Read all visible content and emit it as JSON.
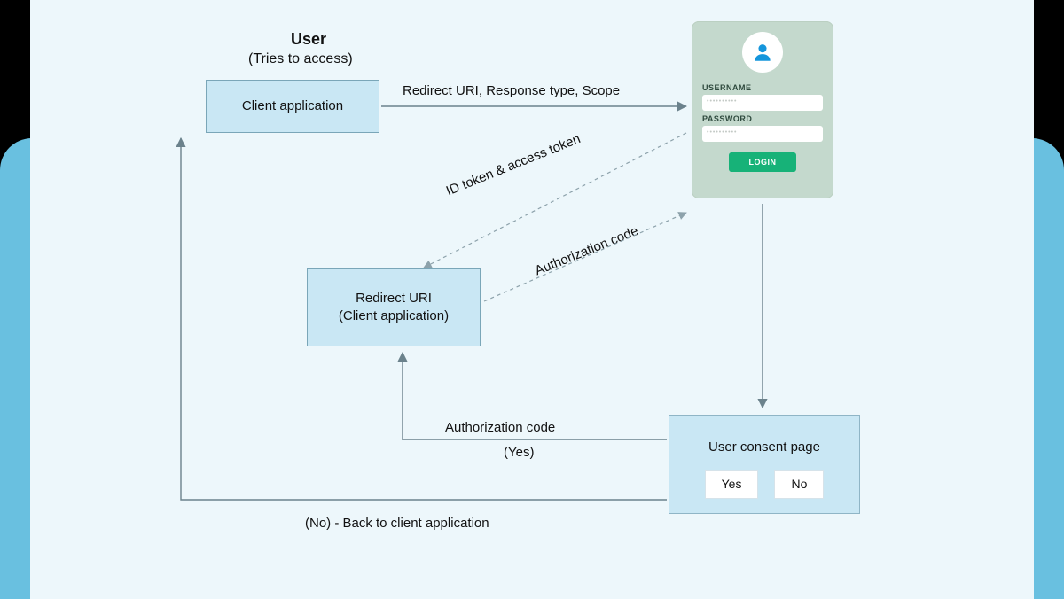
{
  "header": {
    "title": "User",
    "subtitle": "(Tries to access)"
  },
  "nodes": {
    "client_app": {
      "line1": "Client application"
    },
    "redirect": {
      "line1": "Redirect URI",
      "line2": "(Client application)"
    },
    "consent": {
      "title": "User consent page",
      "yes": "Yes",
      "no": "No"
    }
  },
  "login_panel": {
    "username_label": "USERNAME",
    "password_label": "PASSWORD",
    "username_dots": "••••••••••",
    "password_dots": "••••••••••",
    "login_btn": "LOGIN"
  },
  "edge_labels": {
    "to_idp": "Redirect URI, Response type, Scope",
    "token": "ID token & access token",
    "authcode": "Authorization code",
    "auth_yes": "Authorization code",
    "yes": "(Yes)",
    "no_back": "(No) - Back to client application"
  },
  "colors": {
    "node_bg": "#c9e7f4",
    "panel_bg": "#c4d9cd",
    "accent": "#17b278"
  }
}
